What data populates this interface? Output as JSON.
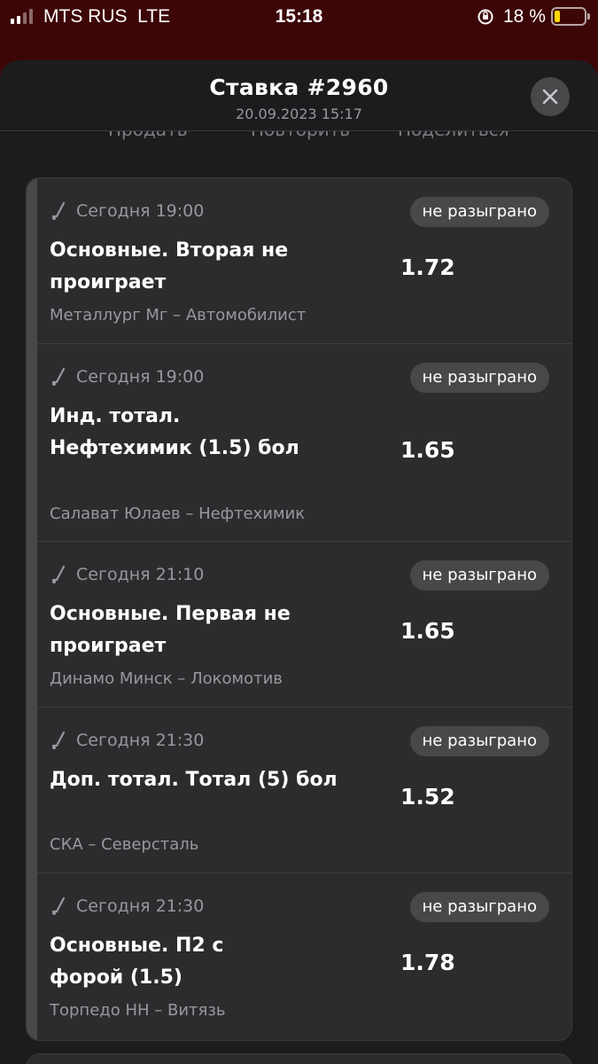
{
  "status_bar": {
    "carrier": "MTS RUS",
    "network": "LTE",
    "time": "15:18",
    "battery_percent": "18 %",
    "battery_color": "#ffd60a"
  },
  "sheet": {
    "title": "Ставка #2960",
    "subtitle": "20.09.2023 15:17",
    "close_icon": "close-icon",
    "actions": [
      "Продать",
      "Повторить",
      "Поделиться"
    ]
  },
  "bets": [
    {
      "time": "Сегодня 19:00",
      "status": "не разыграно",
      "market": "Основные. Вторая не проиграет",
      "odds": "1.72",
      "teams": "Металлург Мг – Автомобилист"
    },
    {
      "time": "Сегодня 19:00",
      "status": "не разыграно",
      "market": "Инд. тотал. Нефтехимик (1.5) бол",
      "odds": "1.65",
      "teams": "Салават Юлаев – Нефтехимик"
    },
    {
      "time": "Сегодня 21:10",
      "status": "не разыграно",
      "market": "Основные. Первая не проиграет",
      "odds": "1.65",
      "teams": "Динамо Минск – Локомотив"
    },
    {
      "time": "Сегодня 21:30",
      "status": "не разыграно",
      "market": "Доп. тотал. Тотал (5) бол",
      "odds": "1.52",
      "teams": "СКА – Северсталь"
    },
    {
      "time": "Сегодня 21:30",
      "status": "не разыграно",
      "market": "Основные. П2 с форой (1.5)",
      "odds": "1.78",
      "teams": "Торпедо НН – Витязь"
    }
  ]
}
